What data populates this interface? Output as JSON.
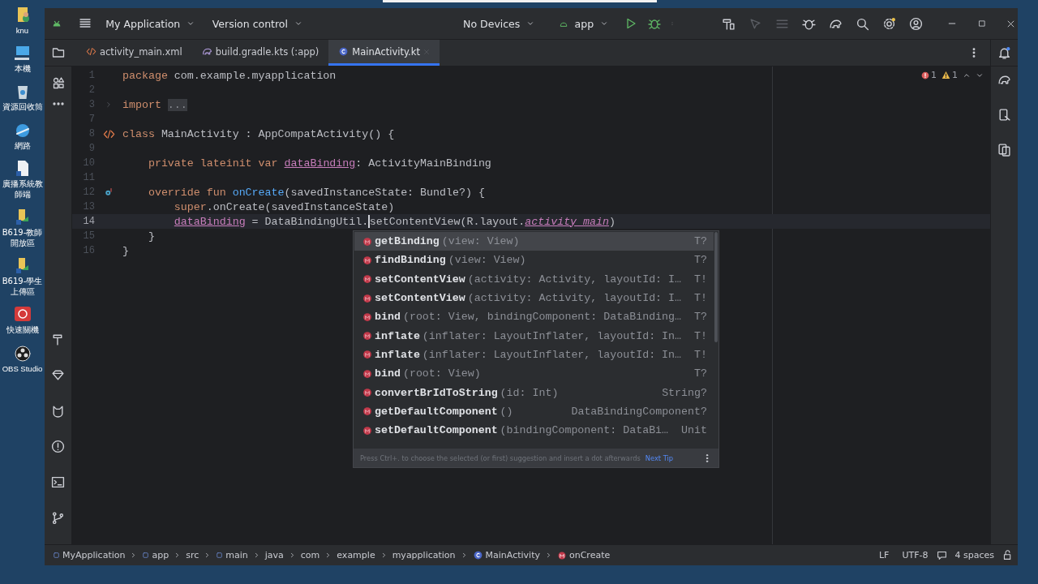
{
  "desktop": {
    "icons": [
      {
        "label": "knu"
      },
      {
        "label": "本機"
      },
      {
        "label": "資源回收筒"
      },
      {
        "label": "網路"
      },
      {
        "label": "廣播系統教師端"
      },
      {
        "label": "B619-教師開放區"
      },
      {
        "label": "B619-學生上傳區"
      },
      {
        "label": "快速關機"
      },
      {
        "label": "OBS Studio"
      }
    ]
  },
  "toolbar": {
    "project": "My Application",
    "vcs": "Version control",
    "device": "No Devices",
    "run_config": "app"
  },
  "tabs": [
    {
      "label": "activity_main.xml",
      "kind": "xml",
      "selected": false
    },
    {
      "label": "build.gradle.kts (:app)",
      "kind": "gradle",
      "selected": false
    },
    {
      "label": "MainActivity.kt",
      "kind": "kotlin",
      "selected": true
    }
  ],
  "inspections": {
    "errors": "1",
    "warnings": "1"
  },
  "code": [
    {
      "number": "1",
      "kind": "plain",
      "current": false,
      "segments": [
        {
          "kind": "keyword",
          "text": "package"
        },
        {
          "kind": "plain",
          "text": " com.example.myapplication"
        }
      ]
    },
    {
      "number": "2",
      "kind": "plain",
      "current": false
    },
    {
      "number": "3",
      "kind": "fold",
      "current": false,
      "segments": [
        {
          "kind": "keyword",
          "text": "import "
        },
        {
          "kind": "folded",
          "text": "..."
        }
      ]
    },
    {
      "number": "7",
      "kind": "plain",
      "current": false
    },
    {
      "number": "8",
      "kind": "layout",
      "current": false,
      "segments": [
        {
          "kind": "keyword",
          "text": "class"
        },
        {
          "kind": "plain",
          "text": " MainActivity : AppCompatActivity() {"
        }
      ]
    },
    {
      "number": "9",
      "kind": "plain",
      "current": false
    },
    {
      "number": "10",
      "kind": "plain",
      "current": false,
      "segments": [
        {
          "kind": "keyword",
          "text": "    private lateinit var "
        },
        {
          "kind": "field",
          "text": "dataBinding"
        },
        {
          "kind": "plain",
          "text": ": ActivityMainBinding"
        }
      ]
    },
    {
      "number": "11",
      "kind": "plain",
      "current": false
    },
    {
      "number": "12",
      "kind": "override",
      "current": false,
      "segments": [
        {
          "kind": "keyword",
          "text": "    override fun "
        },
        {
          "kind": "function",
          "text": "onCreate"
        },
        {
          "kind": "plain",
          "text": "(savedInstanceState: Bundle?) {"
        }
      ]
    },
    {
      "number": "13",
      "kind": "plain",
      "current": false,
      "segments": [
        {
          "kind": "keyword",
          "text": "        super"
        },
        {
          "kind": "plain",
          "text": ".onCreate(savedInstanceState)"
        }
      ]
    },
    {
      "number": "14",
      "kind": "plain",
      "current": true,
      "segments": [
        {
          "kind": "field",
          "text": "        dataBinding"
        },
        {
          "kind": "plain",
          "text": " = DataBindingUtil."
        },
        {
          "kind": "caret"
        },
        {
          "kind": "plain",
          "text": "setContentView(R.layout."
        },
        {
          "kind": "static",
          "text": "activity_main"
        },
        {
          "kind": "plain",
          "text": ")"
        }
      ]
    },
    {
      "number": "15",
      "kind": "plain",
      "current": false,
      "segments": [
        {
          "kind": "plain",
          "text": "    }"
        }
      ]
    },
    {
      "number": "16",
      "kind": "plain",
      "current": false,
      "segments": [
        {
          "kind": "plain",
          "text": "}"
        }
      ]
    }
  ],
  "completion": {
    "items": [
      {
        "name": "getBinding",
        "params": "(view: View)",
        "type": "T?",
        "selected": true
      },
      {
        "name": "findBinding",
        "params": "(view: View)",
        "type": "T?",
        "selected": false
      },
      {
        "name": "setContentView",
        "params": "(activity: Activity, layoutId: I…",
        "type": "T!",
        "selected": false
      },
      {
        "name": "setContentView",
        "params": "(activity: Activity, layoutId: I…",
        "type": "T!",
        "selected": false
      },
      {
        "name": "bind",
        "params": "(root: View, bindingComponent: DataBinding…",
        "type": "T?",
        "selected": false
      },
      {
        "name": "inflate",
        "params": "(inflater: LayoutInflater, layoutId: In…",
        "type": "T!",
        "selected": false
      },
      {
        "name": "inflate",
        "params": "(inflater: LayoutInflater, layoutId: In…",
        "type": "T!",
        "selected": false
      },
      {
        "name": "bind",
        "params": "(root: View)",
        "type": "T?",
        "selected": false
      },
      {
        "name": "convertBrIdToString",
        "params": "(id: Int)",
        "type": "String?",
        "selected": false
      },
      {
        "name": "getDefaultComponent",
        "params": "()",
        "type": "DataBindingComponent?",
        "selected": false
      },
      {
        "name": "setDefaultComponent",
        "params": "(bindingComponent: DataBi…",
        "type": "Unit",
        "selected": false
      }
    ],
    "hint": "Press Ctrl+. to choose the selected (or first) suggestion and insert a dot afterwards",
    "next_tip": "Next Tip"
  },
  "breadcrumbs": [
    {
      "label": "MyApplication",
      "kind": "module"
    },
    {
      "label": "app",
      "kind": "module"
    },
    {
      "label": "src",
      "kind": "plain"
    },
    {
      "label": "main",
      "kind": "module"
    },
    {
      "label": "java",
      "kind": "plain"
    },
    {
      "label": "com",
      "kind": "plain"
    },
    {
      "label": "example",
      "kind": "plain"
    },
    {
      "label": "myapplication",
      "kind": "plain"
    },
    {
      "label": "MainActivity",
      "kind": "class"
    },
    {
      "label": "onCreate",
      "kind": "method"
    }
  ],
  "status": {
    "line_separator": "LF",
    "encoding": "UTF-8",
    "indent": "4 spaces"
  }
}
